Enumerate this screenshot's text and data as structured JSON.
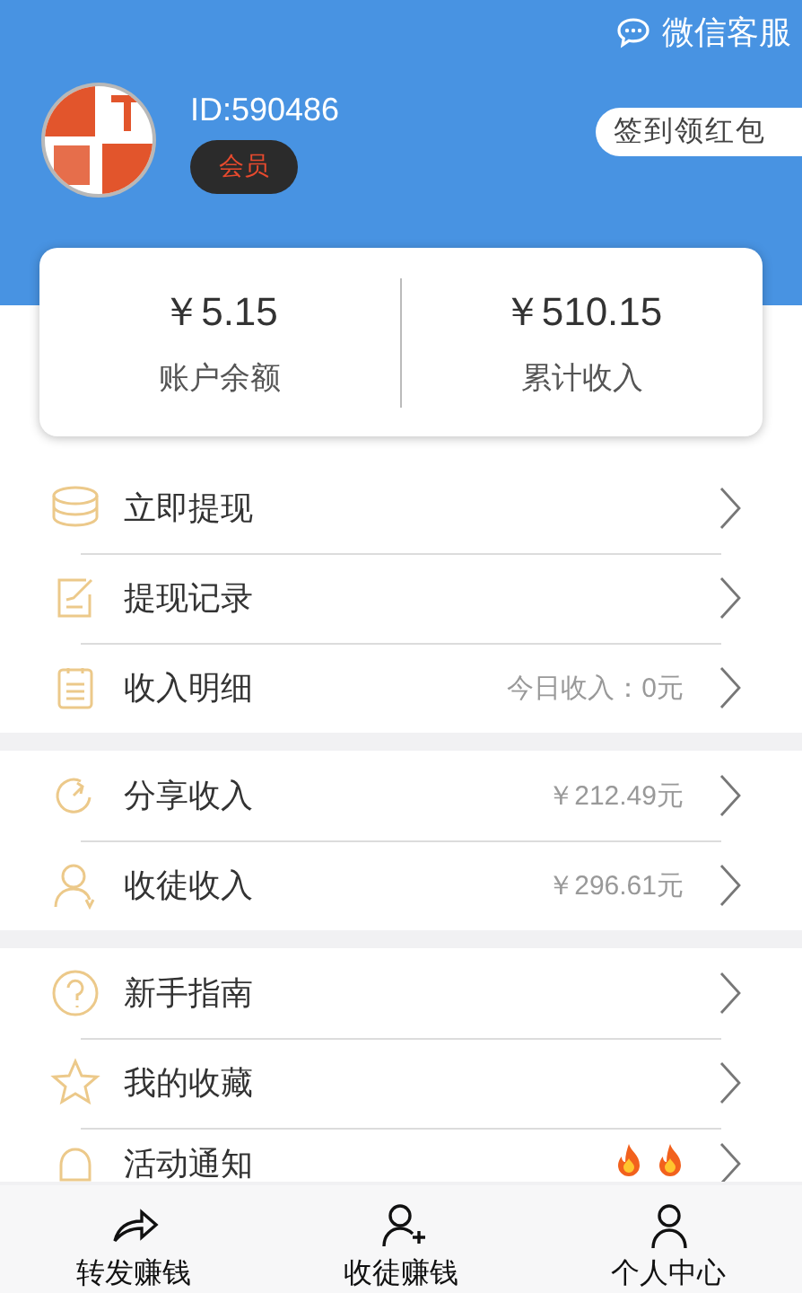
{
  "header": {
    "service_link": "微信客服",
    "user_id": "ID:590486",
    "member_badge": "会员",
    "checkin_button": "签到领红包"
  },
  "balance": [
    {
      "amount": "￥5.15",
      "label": "账户余额"
    },
    {
      "amount": "￥510.15",
      "label": "累计收入"
    }
  ],
  "menu_groups": [
    [
      {
        "label": "立即提现",
        "hot": false
      },
      {
        "label": "提现记录",
        "hot": false
      },
      {
        "label": "收入明细",
        "value": "今日收入：0元",
        "hot": false
      }
    ],
    [
      {
        "label": "分享收入",
        "value": "￥212.49元",
        "hot": false
      },
      {
        "label": "收徒收入",
        "value": "￥296.61元",
        "hot": false
      }
    ],
    [
      {
        "label": "新手指南",
        "hot": false
      },
      {
        "label": "我的收藏",
        "hot": false
      },
      {
        "label": "活动通知",
        "hot": true
      }
    ]
  ],
  "tab_bar": [
    {
      "label": "转发赚钱"
    },
    {
      "label": "收徒赚钱"
    },
    {
      "label": "个人中心"
    }
  ]
}
